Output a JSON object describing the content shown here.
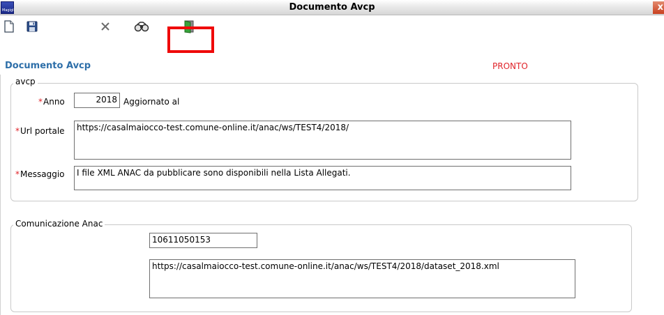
{
  "window": {
    "title": "Documento Avcp",
    "app_icon_text": "Magigli",
    "close_glyph": "x"
  },
  "toolbar": {
    "buttons": [
      {
        "name": "new-document",
        "icon": "blank-page-icon"
      },
      {
        "name": "save",
        "icon": "floppy-disk-icon"
      },
      {
        "name": "delete",
        "icon": "cross-icon"
      },
      {
        "name": "search",
        "icon": "binoculars-icon"
      },
      {
        "name": "exit",
        "icon": "exit-door-icon",
        "highlighted": true
      }
    ],
    "highlight_color": "#ef0a0a"
  },
  "header": {
    "title": "Documento Avcp",
    "status": "PRONTO",
    "title_color": "#2e6fa9",
    "status_color": "#e0242a"
  },
  "avcp": {
    "legend": "avcp",
    "anno_label": "Anno",
    "anno_value": "2018",
    "aggiornato_label": "Aggiornato al",
    "url_label": "Url portale",
    "url_value": "https://casalmaiocco-test.comune-online.it/anac/ws/TEST4/2018/",
    "messaggio_label": "Messaggio",
    "messaggio_value": "I file XML ANAC da pubblicare sono disponibili nella Lista Allegati.",
    "required_marker": "*"
  },
  "comunicazione": {
    "legend": "Comunicazione Anac",
    "code_value": "10611050153",
    "dataset_url": "https://casalmaiocco-test.comune-online.it/anac/ws/TEST4/2018/dataset_2018.xml"
  }
}
